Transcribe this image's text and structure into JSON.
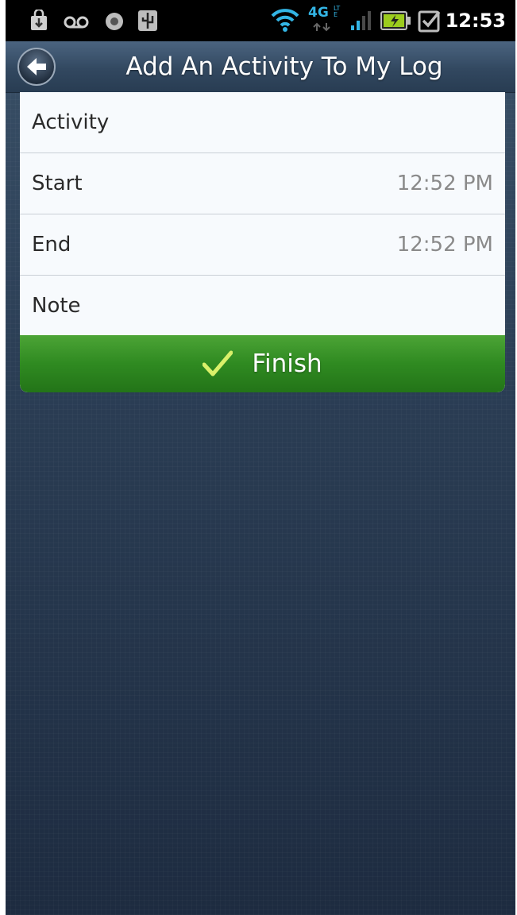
{
  "status_bar": {
    "time": "12:53",
    "network": "4G",
    "network_sub": "LTE",
    "icons": [
      "download-icon",
      "voicemail-icon",
      "notification-dot-icon",
      "usb-icon",
      "wifi-icon",
      "network-4g-lte-icon",
      "signal-icon",
      "battery-charging-icon",
      "checkbox-task-icon"
    ]
  },
  "header": {
    "title": "Add An Activity To My Log",
    "back_icon": "back-arrow-icon"
  },
  "form": {
    "rows": [
      {
        "label": "Activity",
        "value": ""
      },
      {
        "label": "Start",
        "value": "12:52 PM"
      },
      {
        "label": "End",
        "value": "12:52 PM"
      },
      {
        "label": "Note",
        "value": ""
      }
    ],
    "finish_label": "Finish",
    "finish_icon": "checkmark-icon"
  },
  "colors": {
    "finish_green": "#2f8a21",
    "title_bar": "#324860",
    "background": "#2b3e55"
  }
}
